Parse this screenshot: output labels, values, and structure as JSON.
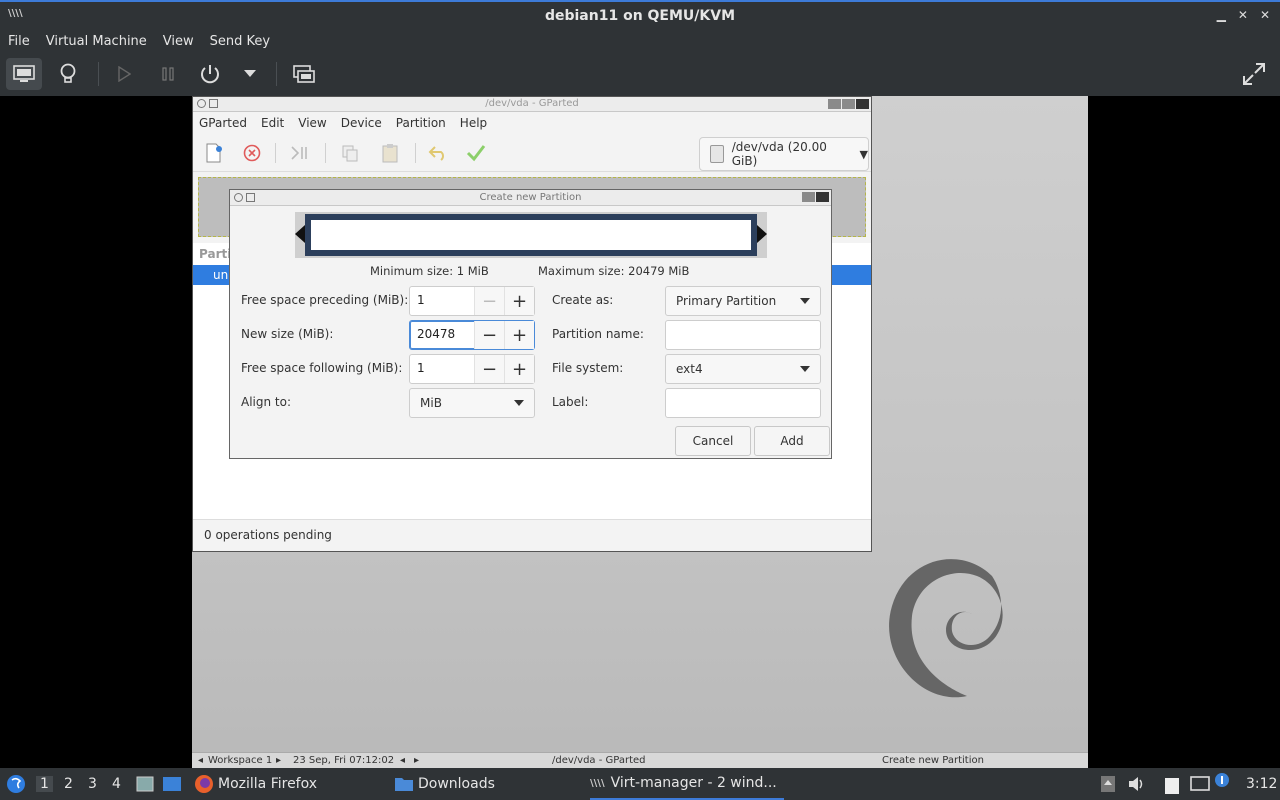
{
  "host": {
    "window_title": "debian11 on QEMU/KVM",
    "menu": [
      "File",
      "Virtual Machine",
      "View",
      "Send Key"
    ]
  },
  "gparted": {
    "title": "/dev/vda - GParted",
    "menu": [
      "GParted",
      "Edit",
      "View",
      "Device",
      "Partition",
      "Help"
    ],
    "device": "/dev/vda (20.00 GiB)",
    "list_header": "Partiti",
    "list_row": "una",
    "status": "0 operations pending"
  },
  "dialog": {
    "title": "Create new Partition",
    "min_size": "Minimum size: 1 MiB",
    "max_size": "Maximum size: 20479 MiB",
    "free_preceding_label": "Free space preceding (MiB):",
    "free_preceding_value": "1",
    "new_size_label": "New size (MiB):",
    "new_size_value": "20478",
    "free_following_label": "Free space following (MiB):",
    "free_following_value": "1",
    "align_label": "Align to:",
    "align_value": "MiB",
    "create_as_label": "Create as:",
    "create_as_value": "Primary Partition",
    "partition_name_label": "Partition name:",
    "partition_name_value": "",
    "filesystem_label": "File system:",
    "filesystem_value": "ext4",
    "label_label": "Label:",
    "label_value": "",
    "cancel": "Cancel",
    "add": "Add"
  },
  "vm_taskbar": {
    "workspace": "Workspace 1",
    "datetime": "23 Sep, Fri 07:12:02",
    "task1": "/dev/vda - GParted",
    "task2": "Create new Partition"
  },
  "panel": {
    "workspaces": [
      "1",
      "2",
      "3",
      "4"
    ],
    "tasks": [
      "Mozilla Firefox",
      "Downloads",
      "Virt-manager - 2 wind..."
    ],
    "clock": "3:12"
  },
  "colors": {
    "host_bg": "#2f3336",
    "accent": "#3d7bd8",
    "selection": "#2f7de0",
    "partition_bar": "#2c3f5c"
  }
}
